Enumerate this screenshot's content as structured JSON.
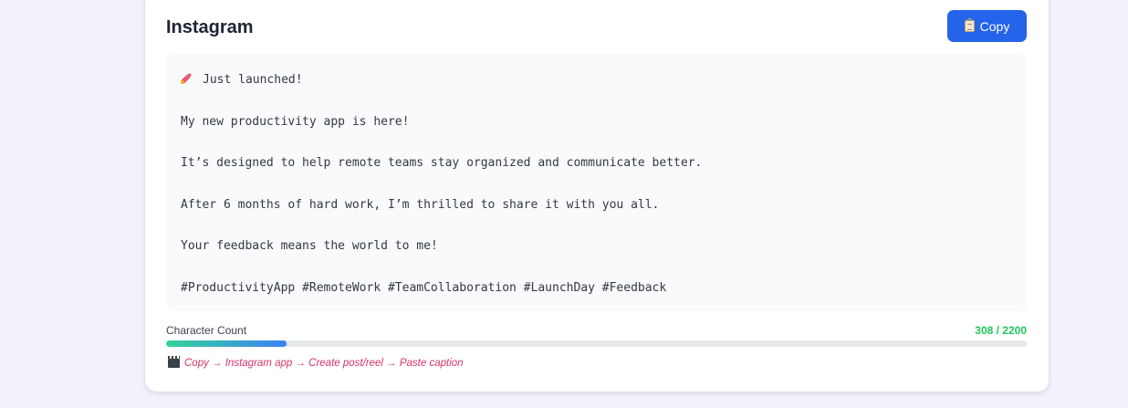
{
  "card": {
    "title": "Instagram",
    "copy_button": {
      "icon": "clipboard-icon",
      "label": "Copy",
      "color": "#2563eb"
    }
  },
  "caption": {
    "lines": [
      {
        "icon": "rocket-icon",
        "text": "Just launched!"
      },
      {
        "text": ""
      },
      {
        "text": "My new productivity app is here!"
      },
      {
        "text": ""
      },
      {
        "text": "It’s designed to help remote teams stay organized and communicate better."
      },
      {
        "text": ""
      },
      {
        "text": "After 6 months of hard work, I’m thrilled to share it with you all."
      },
      {
        "text": ""
      },
      {
        "text": "Your feedback means the world to me!"
      },
      {
        "text": ""
      },
      {
        "text": "#ProductivityApp #RemoteWork #TeamCollaboration #LaunchDay #Feedback"
      }
    ]
  },
  "character_count": {
    "label": "Character Count",
    "display": "308 / 2200",
    "current": 308,
    "max": 2200,
    "value_color": "#22c55e"
  },
  "hint": {
    "icon": "clapper-board-icon",
    "text": "Copy → Instagram app → Create post/reel → Paste caption",
    "color": "#d6336c"
  }
}
